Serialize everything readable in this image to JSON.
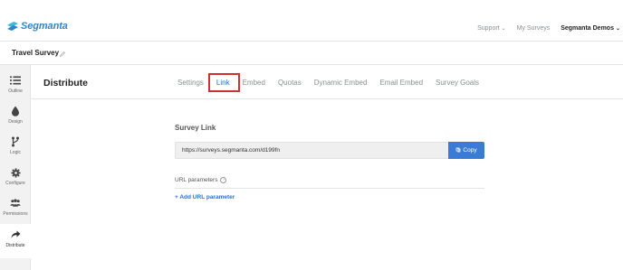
{
  "brand": {
    "name": "Segmanta",
    "accent": "#2e86c9"
  },
  "topnav": {
    "support": "Support",
    "my_surveys": "My Surveys",
    "account": "Segmanta Demos"
  },
  "survey": {
    "title": "Travel Survey"
  },
  "sidebar": {
    "items": [
      {
        "label": "Outline",
        "icon": "list-icon"
      },
      {
        "label": "Design",
        "icon": "drop-icon"
      },
      {
        "label": "Logic",
        "icon": "branch-icon"
      },
      {
        "label": "Configure",
        "icon": "gear-icon"
      },
      {
        "label": "Permissions",
        "icon": "users-icon"
      },
      {
        "label": "Distribute",
        "icon": "share-arrow-icon",
        "active": true
      }
    ]
  },
  "page": {
    "title": "Distribute"
  },
  "tabs": [
    {
      "label": "Settings"
    },
    {
      "label": "Link",
      "active": true
    },
    {
      "label": "Embed"
    },
    {
      "label": "Quotas"
    },
    {
      "label": "Dynamic Embed"
    },
    {
      "label": "Email Embed"
    },
    {
      "label": "Survey Goals"
    }
  ],
  "link_section": {
    "title": "Survey Link",
    "url": "https://surveys.segmanta.com/d199fn",
    "copy_label": "Copy",
    "params_label": "URL parameters",
    "help_icon": "?",
    "add_param_label": "+ Add URL parameter"
  },
  "colors": {
    "primary_button": "#3a7bd5",
    "active_tab": "#2e6fd3",
    "highlight_box": "#d0312d"
  }
}
